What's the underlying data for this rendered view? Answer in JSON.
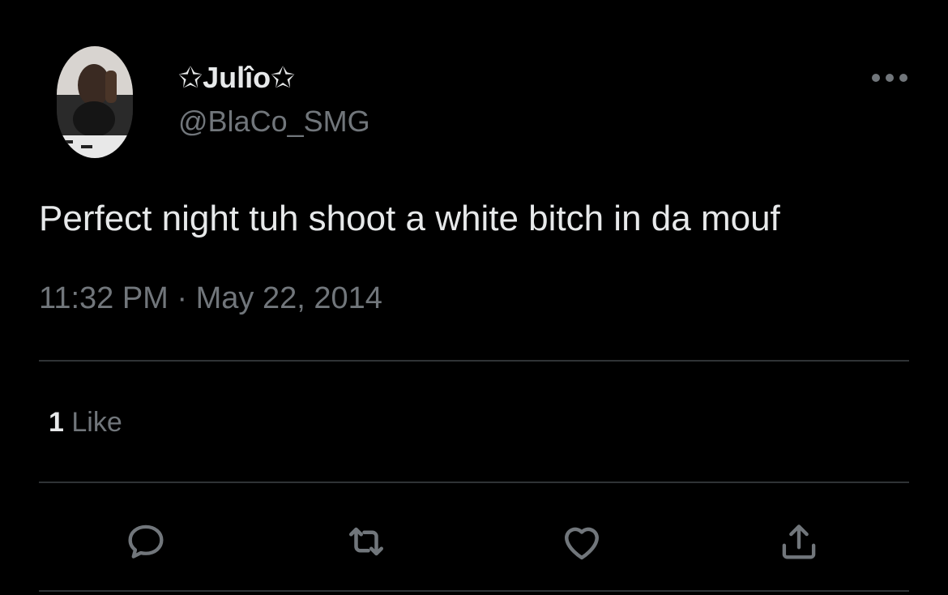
{
  "user": {
    "display_name": "✩Julîo✩",
    "handle": "@BlaCo_SMG"
  },
  "tweet": {
    "text": "Perfect night tuh shoot a white bitch in da mouf",
    "timestamp": "11:32 PM · May 22, 2014"
  },
  "engagement": {
    "likes_count": "1",
    "likes_label": "Like"
  },
  "icons": {
    "more": "more-horizontal-icon",
    "reply": "reply-icon",
    "retweet": "retweet-icon",
    "like": "heart-icon",
    "share": "share-icon"
  },
  "colors": {
    "background": "#000000",
    "primary_text": "#e7e9ea",
    "secondary_text": "#71767b",
    "divider": "#2f3336"
  }
}
